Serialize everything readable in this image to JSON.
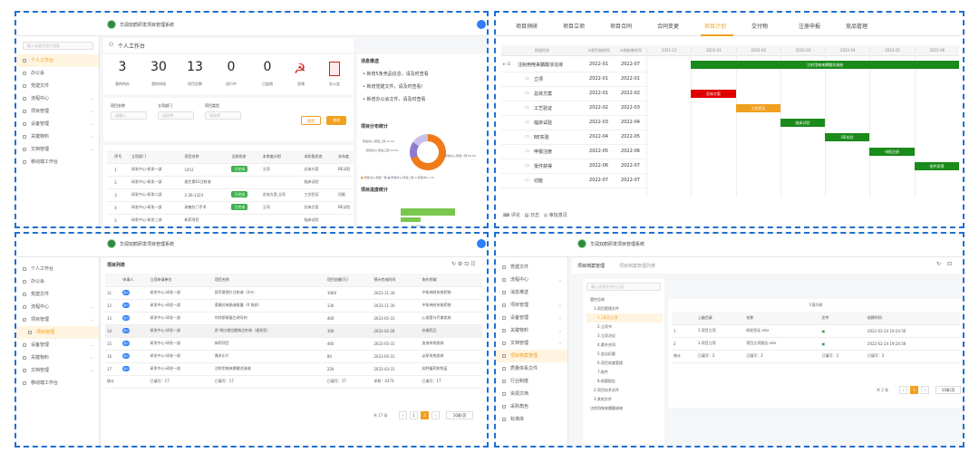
{
  "app": {
    "title": "华润双鹤研发项目管理系统"
  },
  "q1": {
    "search_placeholder": "输入关键字进行搜索",
    "sidebar": [
      {
        "label": "个人工作台",
        "active": true
      },
      {
        "label": "办公会"
      },
      {
        "label": "党建文件"
      },
      {
        "label": "流程中心",
        "arrow": true
      },
      {
        "label": "项目管理",
        "arrow": true
      },
      {
        "label": "设备管理",
        "arrow": true
      },
      {
        "label": "关键物料",
        "arrow": true
      },
      {
        "label": "文档管理",
        "arrow": true
      },
      {
        "label": "移动端工作台"
      }
    ],
    "workbench_title": "个人工作台",
    "stats": [
      {
        "num": "3",
        "label": "我的待办"
      },
      {
        "num": "30",
        "label": "我的待阅"
      },
      {
        "num": "13",
        "label": "项目总数"
      },
      {
        "num": "0",
        "label": "进行中"
      },
      {
        "num": "0",
        "label": "已延期"
      }
    ],
    "party_label": "党建",
    "office_label": "办公会",
    "filters": {
      "name_label": "项目名称",
      "name_ph": "请输入",
      "dept_label": "立项部门",
      "dept_ph": "请选择",
      "type_label": "项目类型",
      "type_ph": "请选择"
    },
    "reset": "重置",
    "search": "查询",
    "table": {
      "headers": [
        "",
        "序号",
        "立项部门",
        "项目名称",
        "当前状态",
        "本季度计划",
        "本阶段状态",
        "本年度"
      ],
      "rows": [
        [
          "1",
          "研发中心-研发一部",
          "1412",
          "已完成",
          "立项",
          "总体方案",
          "BE试验"
        ],
        [
          "2",
          "研发中心-研发一部",
          "维生素K1注射液",
          "",
          "",
          "临床试验",
          ""
        ],
        [
          "3",
          "研发中心-研发二部",
          "2-26-1323",
          "已完成",
          "总体方案,立项",
          "工艺验证",
          "切能"
        ],
        [
          "4",
          "研发中心-研发一部",
          "改善肛门手术",
          "已完成",
          "立项",
          "总体方案",
          "BE试验"
        ],
        [
          "5",
          "研发中心-研发三部",
          "新药项目",
          "",
          "",
          "临床试验",
          ""
        ]
      ]
    },
    "news_title": "消息推送",
    "news": [
      "新增5条竞品信息，请及时查看",
      "新增党建文件，请及时查看!",
      "新增办公会文件，请及时查看"
    ],
    "pie_title": "项目分布统计",
    "pie_labels": [
      "研发中心-研发二部 15.4%",
      "研发中心-研发三部 15.4%",
      "研发中心-研发一部 69.2%"
    ],
    "pie_legend": [
      "研发中心-研发一部",
      "研发中心-研发二部",
      "研发中心"
    ],
    "pie_page": "1/2",
    "progress_title": "项目进度统计",
    "progress_legend": "已完成",
    "pie_values": [
      69.2,
      15.4,
      15.4
    ],
    "pie_colors": [
      "#f07a1a",
      "#8e7bd0",
      "#c8c0e8"
    ]
  },
  "q2": {
    "tabs": [
      "项目预研",
      "项目立项",
      "项目合同",
      "合同变更",
      "项目计划",
      "交付物",
      "注册申报",
      "竞品管理"
    ],
    "active_tab": "项目计划",
    "col_headers": [
      "阶段任务",
      "计划开始时间",
      "计划结束时间"
    ],
    "months": [
      "2021-12",
      "2022-01",
      "2022-02",
      "2022-03",
      "2022-04",
      "2022-05",
      "2022-06"
    ],
    "rows": [
      {
        "name": "注射用唑来膦酸浓溶液",
        "start": "2022-01",
        "end": "2022-07",
        "bar": "注射用唑来膦酸浓溶液",
        "color": "#1a8a1a",
        "s": 1,
        "e": 7,
        "folder": true
      },
      {
        "name": "立项",
        "start": "2022-01",
        "end": "2022-01"
      },
      {
        "name": "总体方案",
        "start": "2022-01",
        "end": "2022-02",
        "bar": "总体方案",
        "color": "#e00000",
        "s": 1,
        "e": 2
      },
      {
        "name": "工艺验证",
        "start": "2022-02",
        "end": "2022-03",
        "bar": "工艺验证",
        "color": "#f0a020",
        "s": 2,
        "e": 3
      },
      {
        "name": "临床试验",
        "start": "2022-03",
        "end": "2022-04",
        "bar": "临床试验",
        "color": "#1a8a1a",
        "s": 3,
        "e": 4
      },
      {
        "name": "BE实验",
        "start": "2022-04",
        "end": "2022-05",
        "bar": "BE实验",
        "color": "#1a8a1a",
        "s": 4,
        "e": 5
      },
      {
        "name": "申报注册",
        "start": "2022-05",
        "end": "2022-06",
        "bar": "申报注册",
        "color": "#1a8a1a",
        "s": 5,
        "e": 6
      },
      {
        "name": "批件获得",
        "start": "2022-06",
        "end": "2022-07",
        "bar": "批件获得",
        "color": "#1a8a1a",
        "s": 6,
        "e": 7
      },
      {
        "name": "切能",
        "start": "2022-07",
        "end": "2022-07"
      }
    ],
    "footer": [
      "评论",
      "日志",
      "审批意见"
    ]
  },
  "q3": {
    "sidebar": [
      {
        "label": "个人工作台"
      },
      {
        "label": "办公会"
      },
      {
        "label": "党建文件"
      },
      {
        "label": "流程中心",
        "arrow": true
      },
      {
        "label": "项目管理",
        "arrow": true
      },
      {
        "label": "项目管理",
        "active": true,
        "sub": true
      },
      {
        "label": "设备管理",
        "arrow": true
      },
      {
        "label": "关键物料",
        "arrow": true
      },
      {
        "label": "文档管理",
        "arrow": true
      },
      {
        "label": "移动端工作台"
      }
    ],
    "list_title": "项目列表",
    "headers": [
      "",
      "申请人",
      "立项申请单位",
      "项目名称",
      "项目金额(万)",
      "预计完成时间",
      "协作领域"
    ],
    "rows": [
      [
        "11",
        "研发中心-研发一部",
        "舒芬莫德片注射液（2m）",
        "1900",
        "2023-11-30",
        "中枢神经系统药物"
      ],
      [
        "12",
        "研发中心-研发一部",
        "奥美拉唑肠溶胶囊（6 铁质）",
        "130",
        "2023-11-30",
        "中枢神经系统药物"
      ],
      [
        "13",
        "研发中心-研发一部",
        "利伐斯联蛋白诱导剂",
        "400",
        "2023-05-31",
        "心血管与代谢疾病"
      ],
      [
        "14",
        "研发中心-研发一部",
        "舒 地比格拉酸钠注射液（速效型）",
        "300",
        "2022-02-28",
        "抗癌药品"
      ],
      [
        "15",
        "研发中心-研发一部",
        "新药项目",
        "460",
        "2023-05-31",
        "血液系统疾病"
      ],
      [
        "16",
        "研发中心-研发一部",
        "属关乐片",
        "80",
        "2023-05-31",
        "泌尿系统疾病"
      ],
      [
        "17",
        "研发中心-研发一部",
        "注射用唑来膦酸浓溶液",
        "220",
        "2023-03-31",
        "抗肿瘤药和免疫"
      ]
    ],
    "applicant": "用户",
    "summary": [
      "统计",
      "已填写：17",
      "已填写：17",
      "已填写：17",
      "求和：4373",
      "已填写：17"
    ],
    "pager": {
      "total": "共 17 条",
      "current": "2",
      "size": "10条/页"
    }
  },
  "q4": {
    "sidebar": [
      {
        "label": "党建文件"
      },
      {
        "label": "流程中心",
        "arrow": true
      },
      {
        "label": "消息推送"
      },
      {
        "label": "项目管理",
        "arrow": true
      },
      {
        "label": "设备管理",
        "arrow": true
      },
      {
        "label": "关键物料",
        "arrow": true
      },
      {
        "label": "文档管理",
        "arrow": true
      },
      {
        "label": "项目档案管理",
        "active": true
      },
      {
        "label": "质量体系文件"
      },
      {
        "label": "行业制度"
      },
      {
        "label": "资源文档"
      },
      {
        "label": "采购角色"
      },
      {
        "label": "标准库"
      }
    ],
    "tab_active": "项目档案管理",
    "tab_other": "项目档案管理列表",
    "search_ph": "输入关键字进行过滤",
    "tree": [
      "管控总体",
      "1.项目管理文件",
      "1.1项目立项",
      "2.立项书",
      "3.立项决议",
      "4.委外合同",
      "5.会议纪要",
      "6.项目进度管理",
      "7.批件",
      "8.结题报告",
      "2.项目技术文件",
      "3.其他文件",
      "注射用唑来膦酸溶液"
    ],
    "table_title": "下载列表",
    "headers": [
      "",
      "上级目录",
      "名称",
      "文件",
      "创建时间"
    ],
    "rows": [
      [
        "1",
        "1.项目立项",
        "研发验证.xlsx",
        "2022-02-24 19:24:56"
      ],
      [
        "2",
        "1.项目立项",
        "项目立项报告.xlsx",
        "2022-02-24 19:24:56"
      ]
    ],
    "summary": [
      "统计",
      "已填写：2",
      "已填写：2",
      "已填写：2",
      "已填写：2"
    ],
    "pager": {
      "total": "共 2 条",
      "current": "1",
      "size": "10条/页"
    }
  }
}
